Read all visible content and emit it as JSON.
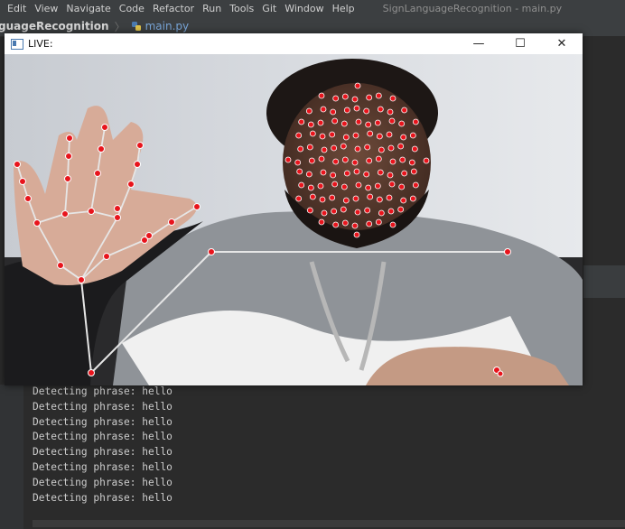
{
  "menu": [
    "Edit",
    "View",
    "Navigate",
    "Code",
    "Refactor",
    "Run",
    "Tools",
    "Git",
    "Window",
    "Help"
  ],
  "ide_title": "SignLanguageRecognition - main.py",
  "breadcrumb": {
    "project": "guageRecognition",
    "file": "main.py"
  },
  "live_window": {
    "title": "LIVE:",
    "controls": {
      "minimize": "—",
      "maximize": "☐",
      "close": "✕"
    }
  },
  "console": {
    "lines": [
      "Detecting phrase: hello",
      "Detecting phrase: hello",
      "Detecting phrase: hello",
      "Detecting phrase: hello",
      "Detecting phrase: hello",
      "Detecting phrase: hello",
      "Detecting phrase: hello",
      "Detecting phrase: hello"
    ]
  },
  "colors": {
    "landmark": "#e8141c",
    "connector": "#e6e6e6",
    "ide_bg": "#2b2b2b",
    "menubar": "#3c3f41"
  }
}
